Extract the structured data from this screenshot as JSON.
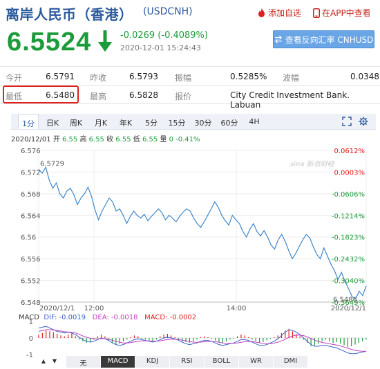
{
  "header": {
    "title": "离岸人民币（香港）",
    "symbol": "(USDCNH)",
    "add_watchlist": "添加自选",
    "app_view": "在APP中查看"
  },
  "quote": {
    "price": "6.5524",
    "change": "-0.0269 (-0.4089%)",
    "timestamp": "2020-12-01 15:24:43",
    "reverse_button": "查看反向汇率 CNHUSD"
  },
  "table": {
    "row1": [
      {
        "label": "今开",
        "value": "6.5791"
      },
      {
        "label": "昨收",
        "value": "6.5793"
      },
      {
        "label": "振幅",
        "value": "0.5285%"
      },
      {
        "label": "波幅",
        "value": "0.0348"
      }
    ],
    "row2": [
      {
        "label": "最低",
        "value": "6.5480"
      },
      {
        "label": "最高",
        "value": "6.5828"
      },
      {
        "label": "报价",
        "value": "City Credit Investment Bank. Labuan"
      }
    ]
  },
  "tabs": [
    "1分",
    "日K",
    "周K",
    "月K",
    "年K",
    "5分",
    "15分",
    "30分",
    "60分",
    "4H"
  ],
  "active_tab": "1分",
  "stats": {
    "date": "2020/12/01",
    "open_label": "开",
    "open": "6.55",
    "high_label": "高",
    "high": "6.55",
    "close_label": "收",
    "close": "6.55",
    "low_label": "低",
    "low": "6.55",
    "vol_label": "量",
    "vol": "0",
    "pct": "-0.41%"
  },
  "chart_data": {
    "type": "line",
    "yticks": [
      "6.576",
      "6.572",
      "6.568",
      "6.564",
      "6.56",
      "6.556",
      "6.552",
      "6.548"
    ],
    "pct_ticks": [
      "0.0612%",
      "0.0003%",
      "-0.0606%",
      "-0.1214%",
      "-0.1823%",
      "-0.2432%",
      "-0.3040%",
      "-0.3649%"
    ],
    "xticks": [
      "2020/12/1",
      "12:00",
      "14:00",
      "2020/12/1"
    ],
    "ylim": [
      6.548,
      6.576
    ],
    "high_annotation": "6.5729",
    "low_annotation": "6.5486",
    "watermark": "sina 新浪财经",
    "values": [
      6.5725,
      6.5718,
      6.5729,
      6.5705,
      6.569,
      6.57,
      6.568,
      6.5672,
      6.5685,
      6.569,
      6.5678,
      6.566,
      6.5672,
      6.568,
      6.5692,
      6.5675,
      6.565,
      6.5632,
      6.5648,
      6.566,
      6.5672,
      6.5665,
      6.5648,
      6.5652,
      6.564,
      6.5625,
      6.5638,
      6.5648,
      6.564,
      6.5635,
      6.5642,
      6.563,
      6.5638,
      6.5645,
      6.5652,
      6.5645,
      6.5632,
      6.564,
      6.5635,
      6.5628,
      6.5638,
      6.5646,
      6.5652,
      6.5648,
      6.5635,
      6.5625,
      6.5618,
      6.5628,
      6.564,
      6.5652,
      6.5665,
      6.5655,
      6.564,
      6.563,
      6.5622,
      6.564,
      6.5632,
      6.5625,
      6.561,
      6.56,
      6.5615,
      6.5625,
      6.561,
      6.5602,
      6.5612,
      6.56,
      6.5585,
      6.5578,
      6.5595,
      6.5605,
      6.5592,
      6.5575,
      6.556,
      6.557,
      6.5583,
      6.5595,
      6.5605,
      6.5598,
      6.5582,
      6.5568,
      6.556,
      6.558,
      6.5565,
      6.555,
      6.5538,
      6.5522,
      6.5535,
      6.5518,
      6.5505,
      6.549,
      6.5486,
      6.55,
      6.5492,
      6.551
    ]
  },
  "macd": {
    "label": "MACD",
    "dif": "DIF: -0.0019",
    "dea": "DEA: -0.0018",
    "macd_val": "MACD: -0.0002",
    "yticks": [
      "1",
      "0",
      "-1"
    ],
    "hist": [
      0.2,
      0.3,
      0.45,
      0.4,
      0.35,
      0.25,
      0.15,
      0.1,
      0.2,
      0.3,
      0.1,
      -0.1,
      -0.2,
      -0.3,
      -0.25,
      -0.1,
      0.1,
      0.2,
      0.1,
      -0.15,
      -0.3,
      -0.4,
      -0.35,
      -0.2,
      -0.1,
      0.05,
      0.15,
      0.1,
      -0.05,
      -0.1,
      -0.15,
      -0.2,
      -0.1,
      0.1,
      0.2,
      0.25,
      0.15,
      0.05,
      -0.1,
      -0.2,
      -0.25,
      -0.3,
      -0.2,
      -0.1,
      0.05,
      0.1,
      0.05,
      -0.05,
      -0.15,
      -0.25,
      -0.3,
      -0.2,
      -0.1,
      -0.05,
      0.1,
      0.2,
      0.15,
      0.05,
      -0.1,
      -0.2,
      -0.3,
      -0.25,
      -0.15,
      -0.05,
      0.05,
      0.15,
      0.3,
      0.45,
      0.55,
      0.4,
      0.25,
      0.1,
      -0.1,
      -0.3,
      -0.5,
      -0.45,
      -0.35,
      -0.2,
      -0.1,
      -0.2,
      -0.3,
      -0.25,
      -0.35,
      -0.45,
      -0.55,
      -0.5,
      -0.4,
      -0.3,
      -0.2,
      -0.1
    ],
    "dif_line": [
      0.6,
      0.65,
      0.7,
      0.6,
      0.5,
      0.4,
      0.35,
      0.3,
      0.35,
      0.3,
      0.2,
      0.05,
      -0.1,
      -0.2,
      -0.25,
      -0.2,
      -0.1,
      0.0,
      -0.05,
      -0.15,
      -0.3,
      -0.4,
      -0.45,
      -0.4,
      -0.3,
      -0.2,
      -0.1,
      -0.05,
      -0.1,
      -0.15,
      -0.2,
      -0.25,
      -0.2,
      -0.1,
      0.0,
      0.05,
      0.0,
      -0.05,
      -0.15,
      -0.25,
      -0.35,
      -0.4,
      -0.35,
      -0.3,
      -0.2,
      -0.15,
      -0.15,
      -0.2,
      -0.3,
      -0.4,
      -0.45,
      -0.4,
      -0.35,
      -0.3,
      -0.2,
      -0.1,
      -0.1,
      -0.15,
      -0.25,
      -0.35,
      -0.45,
      -0.45,
      -0.4,
      -0.3,
      -0.2,
      -0.05,
      0.15,
      0.35,
      0.5,
      0.45,
      0.35,
      0.2,
      0.0,
      -0.2,
      -0.4,
      -0.5,
      -0.5,
      -0.45,
      -0.45,
      -0.5,
      -0.55,
      -0.6,
      -0.7,
      -0.8,
      -0.9,
      -0.95,
      -0.95,
      -0.9,
      -0.85,
      -0.8
    ],
    "dea_line": [
      0.4,
      0.45,
      0.5,
      0.5,
      0.48,
      0.45,
      0.42,
      0.38,
      0.36,
      0.34,
      0.3,
      0.22,
      0.12,
      0.05,
      -0.02,
      -0.06,
      -0.06,
      -0.04,
      -0.04,
      -0.08,
      -0.14,
      -0.2,
      -0.26,
      -0.3,
      -0.3,
      -0.28,
      -0.24,
      -0.2,
      -0.18,
      -0.17,
      -0.18,
      -0.19,
      -0.19,
      -0.17,
      -0.13,
      -0.1,
      -0.08,
      -0.08,
      -0.1,
      -0.13,
      -0.17,
      -0.22,
      -0.25,
      -0.26,
      -0.25,
      -0.23,
      -0.21,
      -0.21,
      -0.22,
      -0.26,
      -0.3,
      -0.32,
      -0.33,
      -0.32,
      -0.3,
      -0.26,
      -0.23,
      -0.21,
      -0.22,
      -0.25,
      -0.29,
      -0.33,
      -0.35,
      -0.34,
      -0.31,
      -0.26,
      -0.18,
      -0.08,
      0.04,
      0.12,
      0.17,
      0.18,
      0.14,
      0.07,
      -0.03,
      -0.13,
      -0.21,
      -0.27,
      -0.31,
      -0.35,
      -0.39,
      -0.43,
      -0.48,
      -0.55,
      -0.62,
      -0.69,
      -0.75,
      -0.78,
      -0.8,
      -0.8
    ]
  },
  "indicator_tabs": [
    "无",
    "MACD",
    "KDJ",
    "RSI",
    "BOLL",
    "WR",
    "DMI"
  ],
  "active_indicator": "MACD",
  "colors": {
    "up": "#e0201c",
    "down": "#1c9b3b",
    "line": "#3f86c8",
    "dif": "#3f63c8",
    "dea": "#c040c0"
  }
}
